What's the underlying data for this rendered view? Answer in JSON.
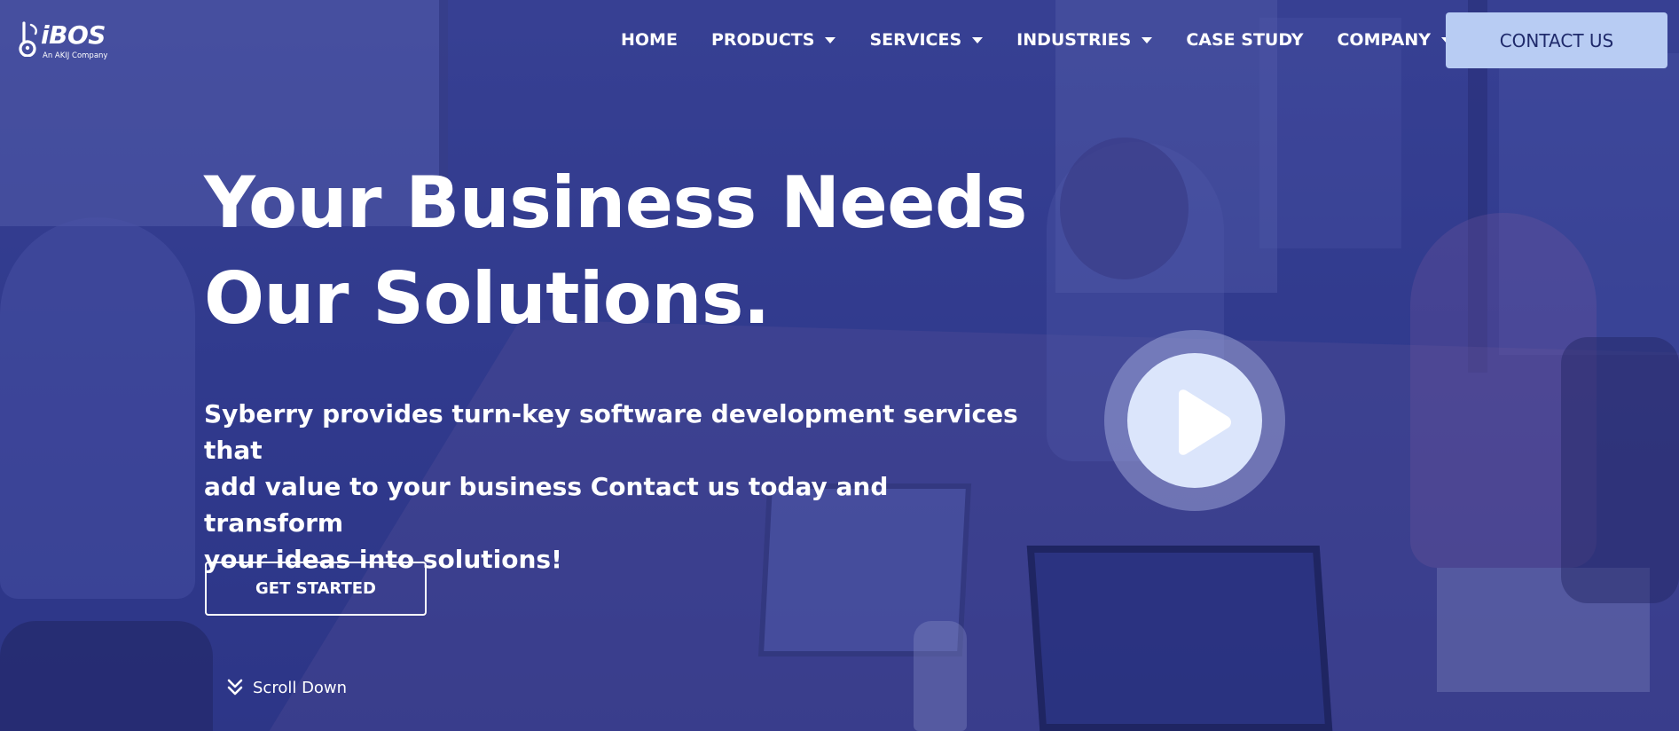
{
  "brand": {
    "name": "iBOS",
    "tagline": "An AKIJ Company"
  },
  "nav": {
    "items": [
      {
        "label": "HOME",
        "has_dropdown": false
      },
      {
        "label": "PRODUCTS",
        "has_dropdown": true
      },
      {
        "label": "SERVICES",
        "has_dropdown": true
      },
      {
        "label": "INDUSTRIES",
        "has_dropdown": true
      },
      {
        "label": "CASE STUDY",
        "has_dropdown": false
      },
      {
        "label": "COMPANY",
        "has_dropdown": true
      }
    ],
    "contact_label": "CONTACT US"
  },
  "hero": {
    "headline_line1": "Your Business Needs",
    "headline_line2": "Our Solutions.",
    "description_line1": "Syberry provides turn-key software development services that",
    "description_line2": "add value to your business Contact us today and transform",
    "description_line3": "your ideas into solutions!",
    "cta_label": "GET STARTED",
    "scroll_label": "Scroll Down"
  },
  "icons": {
    "logo": "ibos-logo-mark",
    "dropdown": "chevron-down-icon",
    "play": "play-icon",
    "scroll": "double-chevron-down-icon"
  },
  "colors": {
    "overlay": "#303a91",
    "contact_button_bg": "#b8ccf3",
    "contact_button_text": "#1f2a6b",
    "play_button_bg": "#dbe5fb",
    "text": "#ffffff"
  }
}
